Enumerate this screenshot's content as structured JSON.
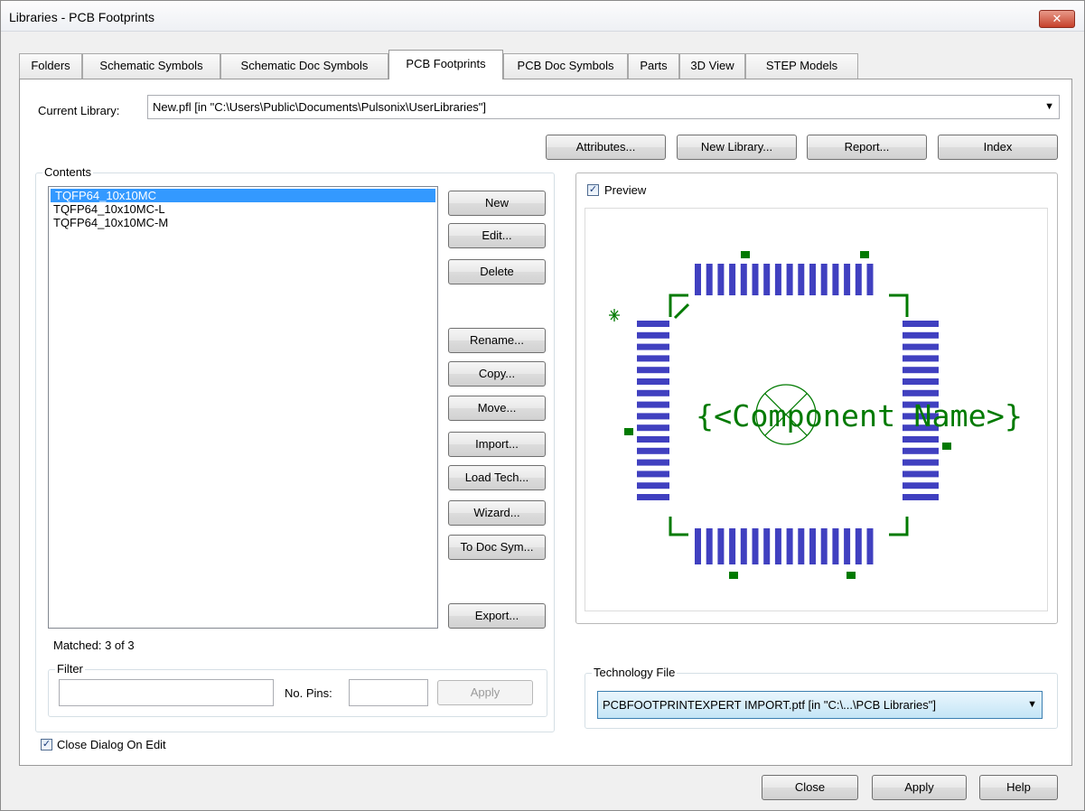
{
  "window": {
    "title": "Libraries - PCB Footprints",
    "close_glyph": "✕"
  },
  "tabs": [
    {
      "label": "Folders"
    },
    {
      "label": "Schematic Symbols"
    },
    {
      "label": "Schematic Doc Symbols"
    },
    {
      "label": "PCB Footprints",
      "active": true
    },
    {
      "label": "PCB Doc Symbols"
    },
    {
      "label": "Parts"
    },
    {
      "label": "3D View"
    },
    {
      "label": "STEP Models"
    }
  ],
  "current_library": {
    "label": "Current Library:",
    "value": "New.pfl   [in \"C:\\Users\\Public\\Documents\\Pulsonix\\UserLibraries\"]"
  },
  "top_buttons": {
    "attributes": "Attributes...",
    "new_library": "New Library...",
    "report": "Report...",
    "index": "Index"
  },
  "contents": {
    "title": "Contents",
    "items": [
      "TQFP64_10x10MC",
      "TQFP64_10x10MC-L",
      "TQFP64_10x10MC-M"
    ],
    "selected_index": 0,
    "matched": "Matched: 3 of 3"
  },
  "side_buttons": {
    "new": "New",
    "edit": "Edit...",
    "delete": "Delete",
    "rename": "Rename...",
    "copy": "Copy...",
    "move": "Move...",
    "import": "Import...",
    "load_tech": "Load Tech...",
    "wizard": "Wizard...",
    "to_doc_sym": "To Doc Sym...",
    "export": "Export..."
  },
  "filter": {
    "title": "Filter",
    "text_value": "",
    "pins_label": "No. Pins:",
    "pins_value": "",
    "apply": "Apply"
  },
  "preview": {
    "label": "Preview",
    "checked": true,
    "component_text": "{<Component Name>}",
    "colors": {
      "pad": "#4040c0",
      "silk": "#007a00"
    }
  },
  "technology": {
    "title": "Technology File",
    "value": "PCBFOOTPRINTEXPERT IMPORT.ptf   [in \"C:\\...\\PCB Libraries\"]"
  },
  "close_on_edit": {
    "label": "Close Dialog On Edit",
    "checked": true
  },
  "bottom_buttons": {
    "close": "Close",
    "apply": "Apply",
    "help": "Help"
  },
  "check_glyph": "✓",
  "dropdown_glyph": "▼"
}
